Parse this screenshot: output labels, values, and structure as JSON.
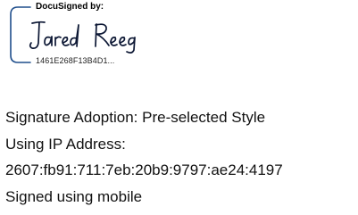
{
  "signature": {
    "header": "DocuSigned by:",
    "signer_name": "Jared Reeg",
    "envelope_id": "1461E268F13B4D1...",
    "frame_color": "#1f4e8c"
  },
  "details": {
    "adoption": "Signature Adoption: Pre-selected Style",
    "ip_label": "Using IP Address:",
    "ip_value": "2607:fb91:711:7eb:20b9:9797:ae24:4197",
    "signed_via": "Signed using mobile"
  }
}
